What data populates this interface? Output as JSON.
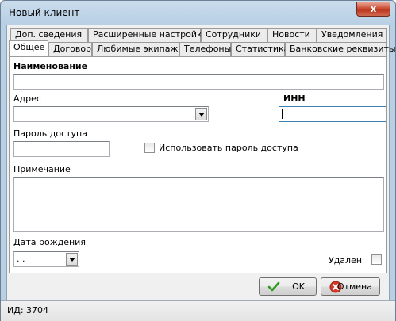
{
  "window": {
    "title": "Новый клиент",
    "close_glyph": "x"
  },
  "tabs_row1": [
    "Доп. сведения",
    "Расширенные настройки",
    "Сотрудники",
    "Новости",
    "Уведомления"
  ],
  "tabs_row2": [
    "Общее",
    "Договор",
    "Любимые экипажи",
    "Телефоны",
    "Статистика",
    "Банковские реквизиты"
  ],
  "active_tab": "Общее",
  "form": {
    "name_label": "Наименование",
    "name_value": "",
    "address_label": "Адрес",
    "address_value": "",
    "inn_label": "ИНН",
    "inn_value": "",
    "password_label": "Пароль доступа",
    "password_value": "",
    "use_password_label": "Использовать пароль доступа",
    "use_password_checked": false,
    "note_label": "Примечание",
    "note_value": "",
    "birth_label": "Дата рождения",
    "birth_value": " .  .",
    "deleted_label": "Удален",
    "deleted_checked": false
  },
  "buttons": {
    "ok": "OK",
    "cancel": "Отмена"
  },
  "status": {
    "text": "ИД: 3704"
  },
  "colors": {
    "ok_check": "#2d9a1e",
    "cancel_icon": "#d23a2a"
  }
}
